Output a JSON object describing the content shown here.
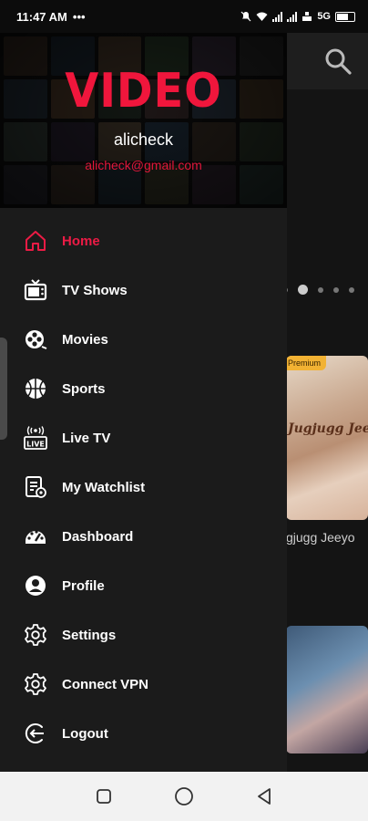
{
  "status_bar": {
    "time": "11:47 AM",
    "dots": "•••",
    "battery_label": "5G"
  },
  "drawer": {
    "logo": "VIDEO",
    "user_name": "alicheck",
    "user_email": "alicheck@gmail.com",
    "items": [
      {
        "label": "Home",
        "icon": "home-icon",
        "active": true
      },
      {
        "label": "TV Shows",
        "icon": "tv-icon",
        "active": false
      },
      {
        "label": "Movies",
        "icon": "film-reel-icon",
        "active": false
      },
      {
        "label": "Sports",
        "icon": "basketball-icon",
        "active": false
      },
      {
        "label": "Live TV",
        "icon": "live-tv-icon",
        "active": false
      },
      {
        "label": "My Watchlist",
        "icon": "watchlist-icon",
        "active": false
      },
      {
        "label": "Dashboard",
        "icon": "dashboard-icon",
        "active": false
      },
      {
        "label": "Profile",
        "icon": "profile-icon",
        "active": false
      },
      {
        "label": "Settings",
        "icon": "settings-icon",
        "active": false
      },
      {
        "label": "Connect VPN",
        "icon": "vpn-settings-icon",
        "active": false
      },
      {
        "label": "Logout",
        "icon": "logout-icon",
        "active": false
      }
    ]
  },
  "background": {
    "poster1_badge": "Premium",
    "poster1_title": "Jugjugg Jeeyo",
    "poster1_caption": "gjugg Jeeyo"
  },
  "colors": {
    "accent": "#ec1b45",
    "drawer_bg": "#1b1b1b"
  }
}
